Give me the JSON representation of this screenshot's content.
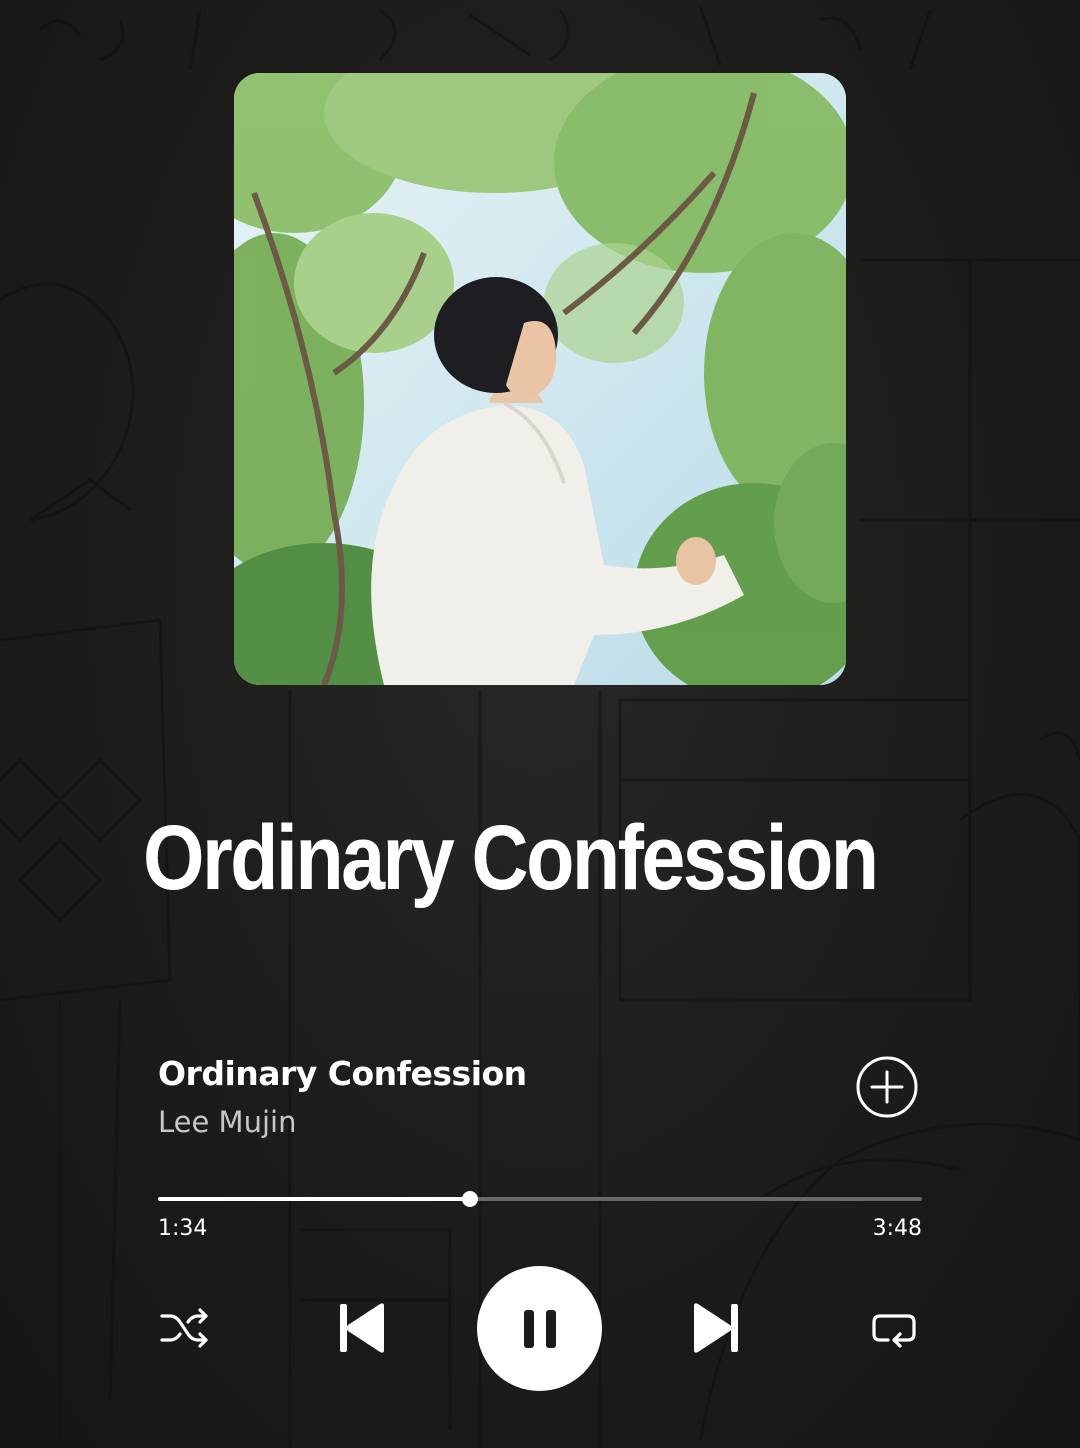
{
  "headline": "Ordinary Confession",
  "track": {
    "title": "Ordinary Confession",
    "artist": "Lee Mujin"
  },
  "playback": {
    "elapsed": "1:34",
    "total": "3:48",
    "progress_fraction": 0.408,
    "state": "playing"
  },
  "icons": {
    "add": "add-circle-icon",
    "shuffle": "shuffle-icon",
    "previous": "skip-previous-icon",
    "pause": "pause-icon",
    "next": "skip-next-icon",
    "repeat": "repeat-icon"
  },
  "colors": {
    "background": "#1c1b1a",
    "text_primary": "#ffffff",
    "text_secondary": "#c9c7c4",
    "progress_remaining": "#6a6866"
  }
}
